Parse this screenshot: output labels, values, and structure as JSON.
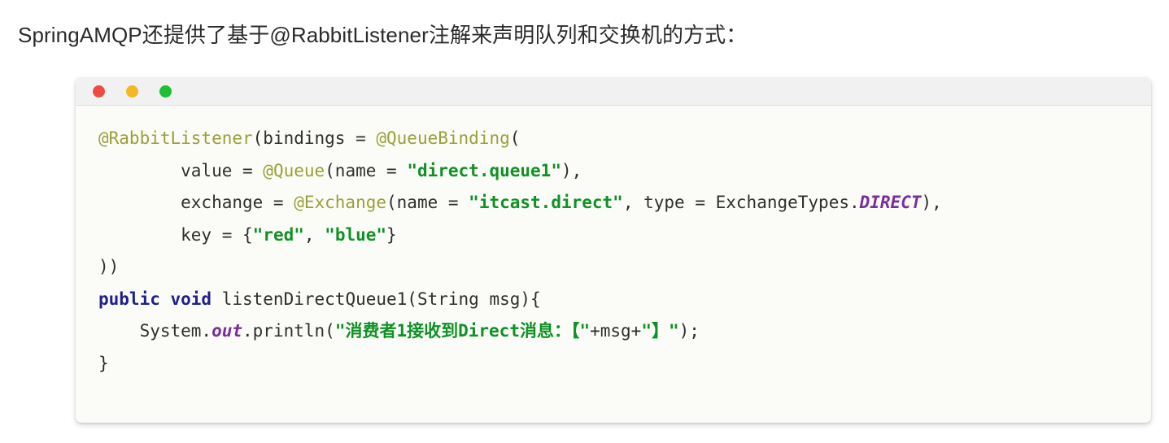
{
  "heading": {
    "text": "SpringAMQP还提供了基于@RabbitListener注解来声明队列和交换机的方式："
  },
  "code_window": {
    "titlebar": {
      "dots": [
        {
          "name": "close",
          "color": "#ee4b45"
        },
        {
          "name": "minimize",
          "color": "#f3b823"
        },
        {
          "name": "maximize",
          "color": "#1fbe33"
        }
      ]
    },
    "language": "java",
    "colors": {
      "background": "#fbfcf7",
      "titlebar": "#f1f1f1",
      "text": "#2e2e2e",
      "annotation": "#9a9f36",
      "string": "#0f9125",
      "keyword": "#1f1f8c",
      "static_field": "#7b2d9e"
    },
    "lines": [
      {
        "id": "line-1",
        "tokens": [
          {
            "t": "@RabbitListener",
            "c": "anno"
          },
          {
            "t": "(bindings = ",
            "c": "plain"
          },
          {
            "t": "@QueueBinding",
            "c": "anno"
          },
          {
            "t": "(",
            "c": "plain"
          }
        ]
      },
      {
        "id": "line-2",
        "tokens": [
          {
            "t": "        value = ",
            "c": "plain"
          },
          {
            "t": "@Queue",
            "c": "anno"
          },
          {
            "t": "(name = ",
            "c": "plain"
          },
          {
            "t": "\"direct.queue1\"",
            "c": "str"
          },
          {
            "t": "),",
            "c": "plain"
          }
        ]
      },
      {
        "id": "line-3",
        "tokens": [
          {
            "t": "        exchange = ",
            "c": "plain"
          },
          {
            "t": "@Exchange",
            "c": "anno"
          },
          {
            "t": "(name = ",
            "c": "plain"
          },
          {
            "t": "\"itcast.direct\"",
            "c": "str"
          },
          {
            "t": ", type = ExchangeTypes.",
            "c": "plain"
          },
          {
            "t": "DIRECT",
            "c": "static"
          },
          {
            "t": "),",
            "c": "plain"
          }
        ]
      },
      {
        "id": "line-4",
        "tokens": [
          {
            "t": "        key = {",
            "c": "plain"
          },
          {
            "t": "\"red\"",
            "c": "str"
          },
          {
            "t": ", ",
            "c": "plain"
          },
          {
            "t": "\"blue\"",
            "c": "str"
          },
          {
            "t": "}",
            "c": "plain"
          }
        ]
      },
      {
        "id": "line-5",
        "tokens": [
          {
            "t": "))",
            "c": "plain"
          }
        ]
      },
      {
        "id": "line-6",
        "tokens": [
          {
            "t": "public void",
            "c": "kw"
          },
          {
            "t": " listenDirectQueue1(String msg){",
            "c": "plain"
          }
        ]
      },
      {
        "id": "line-7",
        "tokens": [
          {
            "t": "    System.",
            "c": "plain"
          },
          {
            "t": "out",
            "c": "static"
          },
          {
            "t": ".println(",
            "c": "plain"
          },
          {
            "t": "\"消费者1接收到Direct消息：【\"",
            "c": "str"
          },
          {
            "t": "+msg+",
            "c": "plain"
          },
          {
            "t": "\"】\"",
            "c": "str"
          },
          {
            "t": ");",
            "c": "plain"
          }
        ]
      },
      {
        "id": "line-8",
        "tokens": [
          {
            "t": "}",
            "c": "plain"
          }
        ]
      }
    ]
  }
}
